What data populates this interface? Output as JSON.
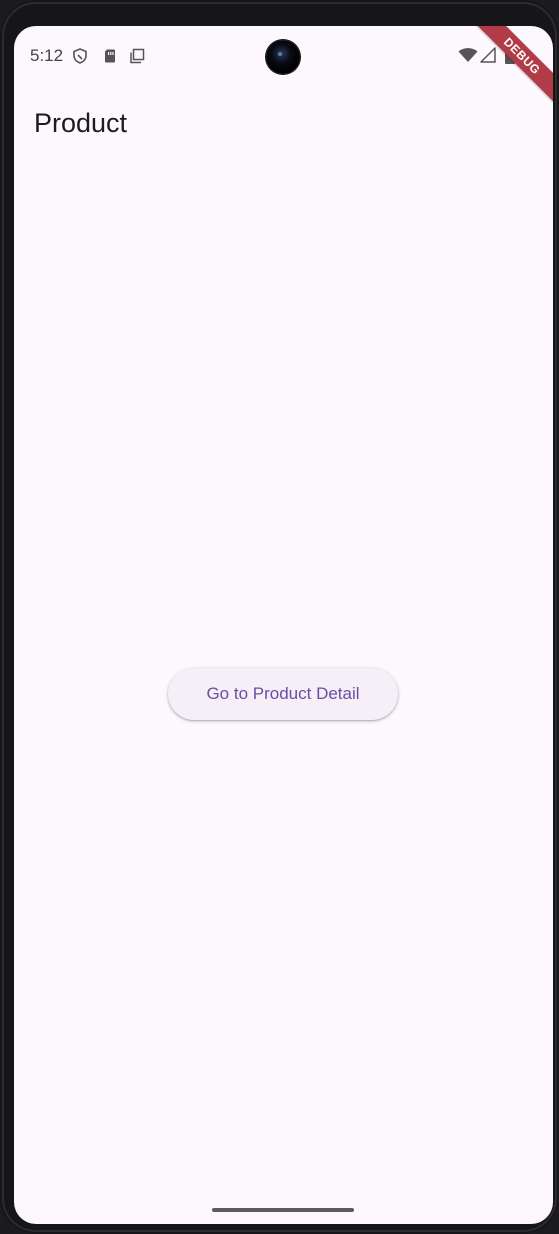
{
  "status_bar": {
    "time": "5:12",
    "left_icons": [
      "shield-icon",
      "sim-card-icon",
      "copy-icon"
    ],
    "right_icons": [
      "wifi-icon",
      "signal-icon",
      "battery-icon"
    ]
  },
  "debug_banner": {
    "label": "DEBUG",
    "color": "#b13b46"
  },
  "app_bar": {
    "title": "Product"
  },
  "main": {
    "button_label": "Go to Product Detail"
  },
  "colors": {
    "background": "#fdf7fe",
    "button_background": "#f5eff7",
    "button_text": "#6a4ea5",
    "title_text": "#1d1b20"
  }
}
